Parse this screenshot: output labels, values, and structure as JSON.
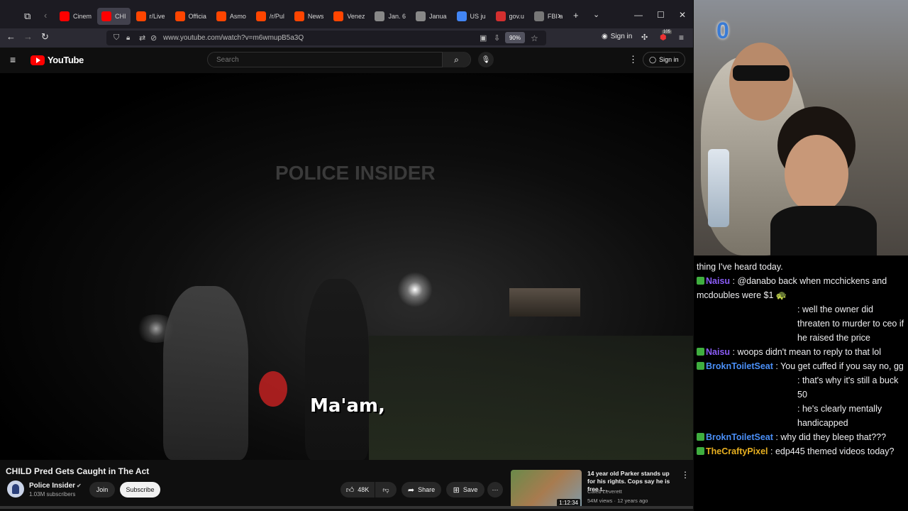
{
  "browser": {
    "tabs": [
      {
        "label": "Cinem",
        "color": "#ff0000",
        "active": false
      },
      {
        "label": "CHI",
        "color": "#ff0000",
        "active": true
      },
      {
        "label": "r/Live",
        "color": "#ff4500",
        "active": false
      },
      {
        "label": "Officia",
        "color": "#ff4500",
        "active": false
      },
      {
        "label": "Asmo",
        "color": "#ff4500",
        "active": false
      },
      {
        "label": "/r/Pul",
        "color": "#ff4500",
        "active": false
      },
      {
        "label": "News",
        "color": "#ff4500",
        "active": false
      },
      {
        "label": "Venez",
        "color": "#ff4500",
        "active": false
      },
      {
        "label": "Jan. 6",
        "color": "#888888",
        "active": false
      },
      {
        "label": "Janua",
        "color": "#888888",
        "active": false
      },
      {
        "label": "US ju",
        "color": "#4285f4",
        "active": false
      },
      {
        "label": "gov.u",
        "color": "#d32f2f",
        "active": false
      },
      {
        "label": "FBI a",
        "color": "#777777",
        "active": false
      }
    ],
    "url": "www.youtube.com/watch?v=m6wmupB5a3Q",
    "zoom": "90%",
    "signin_label": "Sign in",
    "extension_badge": "105"
  },
  "youtube": {
    "logo_text": "YouTube",
    "search_placeholder": "Search",
    "signin_label": "Sign in"
  },
  "video": {
    "watermark": "POLICE INSIDER",
    "caption": "Ma'am,",
    "title": "CHILD Pred Gets Caught in The Act"
  },
  "channel": {
    "name": "Police Insider",
    "subscribers": "1.03M subscribers",
    "join_label": "Join",
    "subscribe_label": "Subscribe"
  },
  "actions": {
    "likes": "48K",
    "share_label": "Share",
    "save_label": "Save"
  },
  "recommended": {
    "title": "14 year old Parker stands up for his rights. Cops say he is free t...",
    "channel": "Caleb Leverett",
    "meta": "54M views · 12 years ago",
    "duration": "1:12:34"
  },
  "webcam": {
    "overlay_number": "0"
  },
  "chat": {
    "messages": [
      {
        "user": "",
        "text": "thing I've heard today.",
        "user_color": "#ffffff",
        "indent": false
      },
      {
        "user": "Naisu",
        "text": " : @danabo back when mcchickens and mcdoubles were $1 🐢",
        "user_color": "#8a5cf6",
        "indent": false
      },
      {
        "user": "",
        "text": ": well the owner did threaten to murder to ceo if he raised the price",
        "user_color": "#ffffff",
        "indent": true
      },
      {
        "user": "Naisu",
        "text": " : woops didn't mean to reply to that lol",
        "user_color": "#8a5cf6",
        "indent": false
      },
      {
        "user": "BroknToiletSeat",
        "text": " : You get cuffed if you say no, gg",
        "user_color": "#4a8ff7",
        "indent": false
      },
      {
        "user": "",
        "text": ": that's why it's still a buck 50",
        "user_color": "#ffffff",
        "indent": true
      },
      {
        "user": "",
        "text": ": he's clearly mentally handicapped",
        "user_color": "#ffffff",
        "indent": true
      },
      {
        "user": "BroknToiletSeat",
        "text": " : why did they bleep that???",
        "user_color": "#4a8ff7",
        "indent": false
      },
      {
        "user": "TheCraftyPixel",
        "text": " : edp445 themed videos today?",
        "user_color": "#e8b020",
        "indent": false
      }
    ]
  }
}
